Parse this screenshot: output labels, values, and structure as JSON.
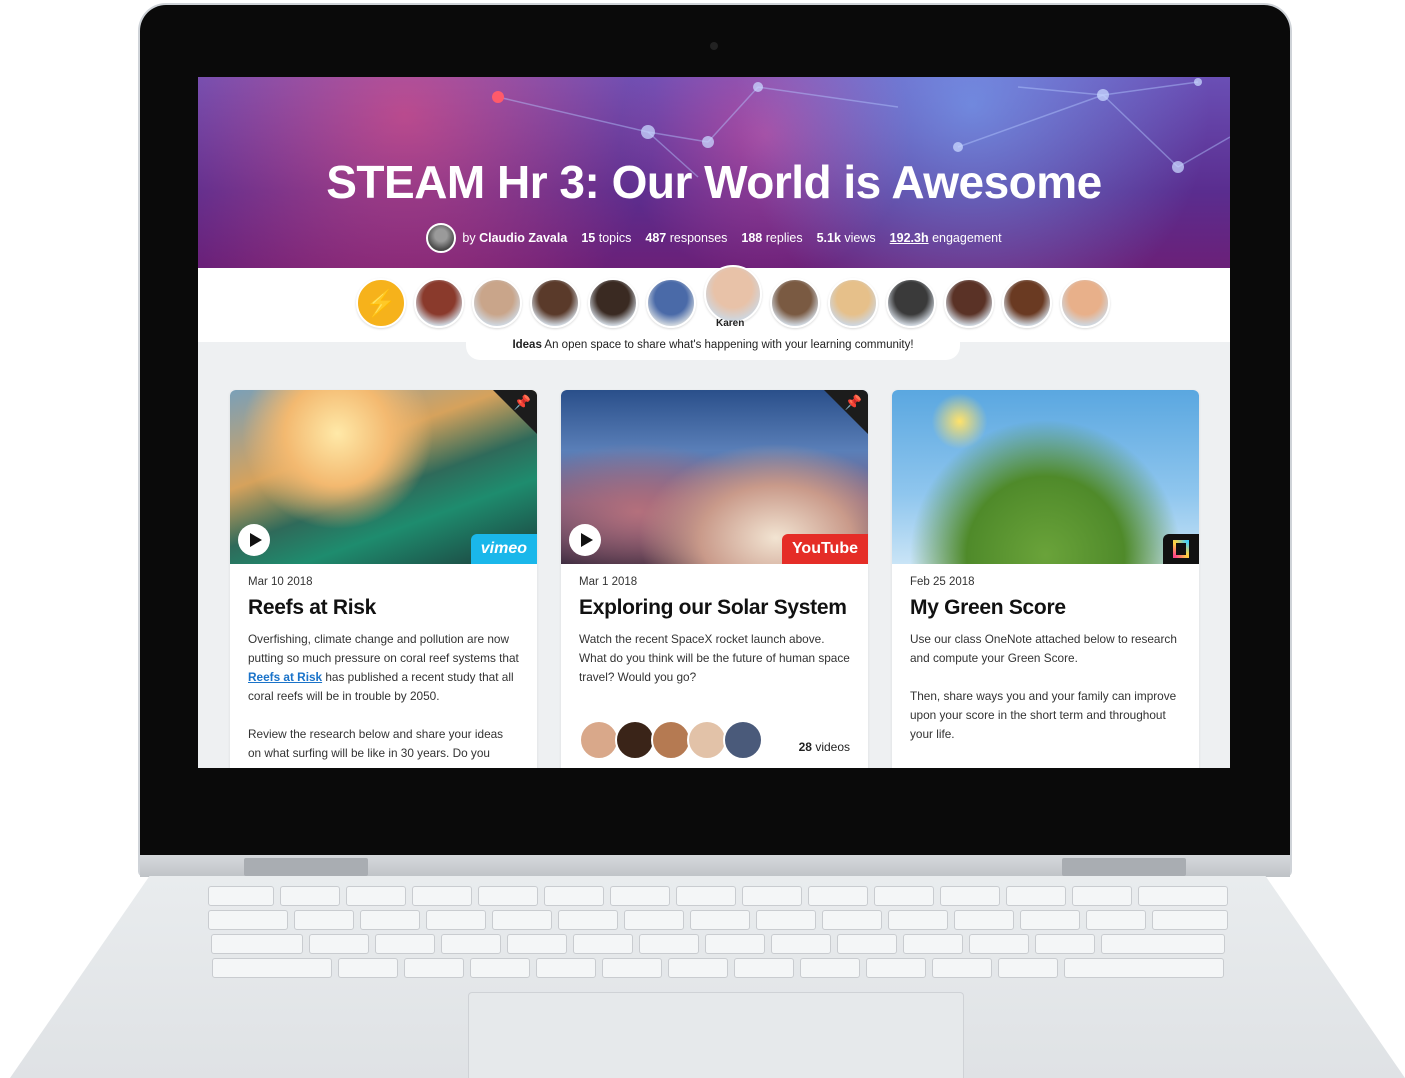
{
  "hero": {
    "title": "STEAM Hr 3: Our World is Awesome",
    "by_label": "by",
    "author": "Claudio Zavala",
    "stats": {
      "topics_count": "15",
      "topics_label": "topics",
      "responses_count": "487",
      "responses_label": "responses",
      "replies_count": "188",
      "replies_label": "replies",
      "views_count": "5.1k",
      "views_label": "views",
      "engagement_count": "192.3h",
      "engagement_label": "engagement"
    }
  },
  "members": {
    "featured_name": "Karen",
    "avatar_colors": [
      "#f6b21b",
      "#8a3a2c",
      "#c9a58a",
      "#5a3a2a",
      "#3a2a22",
      "#4a6aa8",
      "#e8c2a8",
      "#7a5a42",
      "#e6c08a",
      "#3a3a3a",
      "#5a3226",
      "#6a3a22",
      "#e8b08a"
    ]
  },
  "group": {
    "name": "Ideas",
    "description": "An open space to share what's happening with your learning community!"
  },
  "cards": [
    {
      "date": "Mar 10 2018",
      "title": "Reefs at Risk",
      "text_before_link": "Overfishing, climate change and pollution are now putting so much pressure on coral reef systems that ",
      "link": "Reefs at Risk",
      "text_after_link": " has published a recent study that all coral reefs will be in trouble by 2050.",
      "text_para2": "Review the research below and share your ideas on what surfing will be like in 30 years. Do you",
      "badge": "vimeo",
      "icon": "vimeo-logo"
    },
    {
      "date": "Mar 1 2018",
      "title": "Exploring our Solar System",
      "text": "Watch the recent SpaceX rocket launch above. What do you think will be the future of human space travel? Would you go?",
      "video_count": "28",
      "video_label": "videos",
      "badge": "YouTube",
      "icon": "youtube-logo"
    },
    {
      "date": "Feb 25 2018",
      "title": "My Green Score",
      "text": "Use our class OneNote attached below to research and compute your Green Score.",
      "text_para2": "Then, share ways you and your family can improve upon your score in the short term and throughout your life.",
      "icon": "onenote-icon"
    }
  ]
}
